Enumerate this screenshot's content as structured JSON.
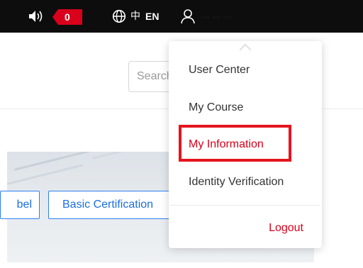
{
  "topbar": {
    "notification_count": "0",
    "lang_zh": "中",
    "lang_en": "EN",
    "username": "··· ··· ···"
  },
  "search": {
    "placeholder": "Search"
  },
  "banner": {
    "tags": [
      "Label",
      "Basic Certification"
    ],
    "tag_visible_text": [
      "bel",
      "Basic Certification"
    ]
  },
  "user_menu": {
    "items": [
      {
        "label": "User Center"
      },
      {
        "label": "My Course"
      },
      {
        "label": "My Information",
        "highlighted": true
      },
      {
        "label": "Identity Verification"
      }
    ],
    "logout_label": "Logout"
  },
  "colors": {
    "topbar_bg": "#0d0d0d",
    "badge_red": "#d9001b",
    "accent_blue": "#1a6fe0",
    "highlight_red": "#e4141d"
  },
  "icons": [
    "speaker-icon",
    "globe-icon",
    "user-icon",
    "chevron-up-icon"
  ]
}
